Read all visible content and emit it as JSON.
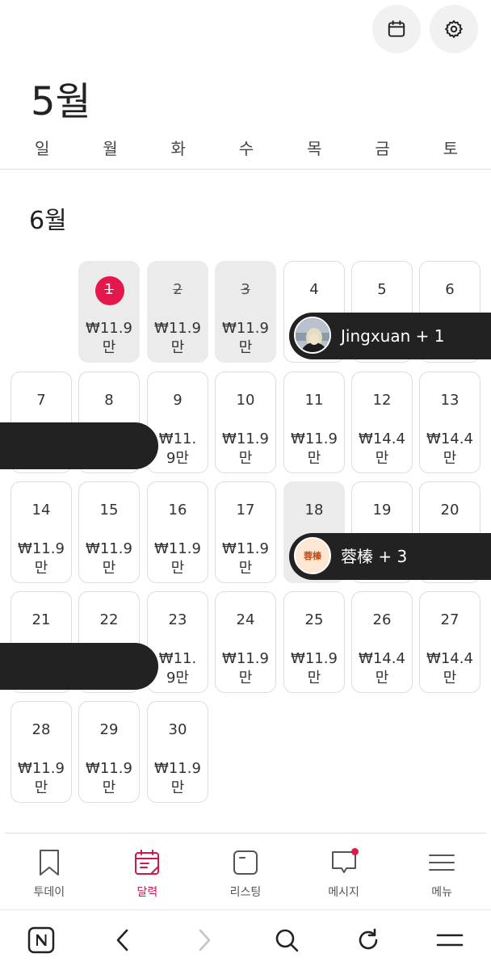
{
  "header": {
    "month_title": "5월"
  },
  "weekdays": [
    "일",
    "월",
    "화",
    "수",
    "목",
    "금",
    "토"
  ],
  "calendar": {
    "section_month": "6월",
    "days": [
      {
        "n": "1",
        "price": "₩11.9\n만",
        "state": "today"
      },
      {
        "n": "2",
        "price": "₩11.9\n만",
        "state": "past"
      },
      {
        "n": "3",
        "price": "₩11.9\n만",
        "state": "past"
      },
      {
        "n": "4",
        "price": "",
        "state": "normal"
      },
      {
        "n": "5",
        "price": "",
        "state": "normal"
      },
      {
        "n": "6",
        "price": "",
        "state": "normal"
      },
      {
        "n": "7",
        "price": "",
        "state": "normal"
      },
      {
        "n": "8",
        "price": "",
        "state": "normal"
      },
      {
        "n": "9",
        "price": "₩11.\n9만",
        "state": "normal"
      },
      {
        "n": "10",
        "price": "₩11.9\n만",
        "state": "normal"
      },
      {
        "n": "11",
        "price": "₩11.9\n만",
        "state": "normal"
      },
      {
        "n": "12",
        "price": "₩14.4\n만",
        "state": "normal"
      },
      {
        "n": "13",
        "price": "₩14.4\n만",
        "state": "normal"
      },
      {
        "n": "14",
        "price": "₩11.9\n만",
        "state": "normal"
      },
      {
        "n": "15",
        "price": "₩11.9\n만",
        "state": "normal"
      },
      {
        "n": "16",
        "price": "₩11.9\n만",
        "state": "normal"
      },
      {
        "n": "17",
        "price": "₩11.9\n만",
        "state": "normal"
      },
      {
        "n": "18",
        "price": "",
        "state": "grey"
      },
      {
        "n": "19",
        "price": "",
        "state": "normal"
      },
      {
        "n": "20",
        "price": "",
        "state": "normal"
      },
      {
        "n": "21",
        "price": "",
        "state": "normal"
      },
      {
        "n": "22",
        "price": "",
        "state": "normal"
      },
      {
        "n": "23",
        "price": "₩11.\n9만",
        "state": "normal"
      },
      {
        "n": "24",
        "price": "₩11.9\n만",
        "state": "normal"
      },
      {
        "n": "25",
        "price": "₩11.9\n만",
        "state": "normal"
      },
      {
        "n": "26",
        "price": "₩14.4\n만",
        "state": "normal"
      },
      {
        "n": "27",
        "price": "₩14.4\n만",
        "state": "normal"
      },
      {
        "n": "28",
        "price": "₩11.9\n만",
        "state": "normal"
      },
      {
        "n": "29",
        "price": "₩11.9\n만",
        "state": "normal"
      },
      {
        "n": "30",
        "price": "₩11.9\n만",
        "state": "normal"
      }
    ],
    "reservations": {
      "guest1": "Jingxuan + 1",
      "guest2": "蓉榛 + 3",
      "guest2_avatar": "蓉榛"
    }
  },
  "tabs": [
    {
      "label": "투데이",
      "icon": "bookmark-icon"
    },
    {
      "label": "달력",
      "icon": "calendar-icon"
    },
    {
      "label": "리스팅",
      "icon": "listing-icon"
    },
    {
      "label": "메시지",
      "icon": "message-icon"
    },
    {
      "label": "메뉴",
      "icon": "menu-icon"
    }
  ],
  "colors": {
    "accent": "#e3174c",
    "pill": "#222222",
    "grey_cell": "#ebebeb"
  }
}
